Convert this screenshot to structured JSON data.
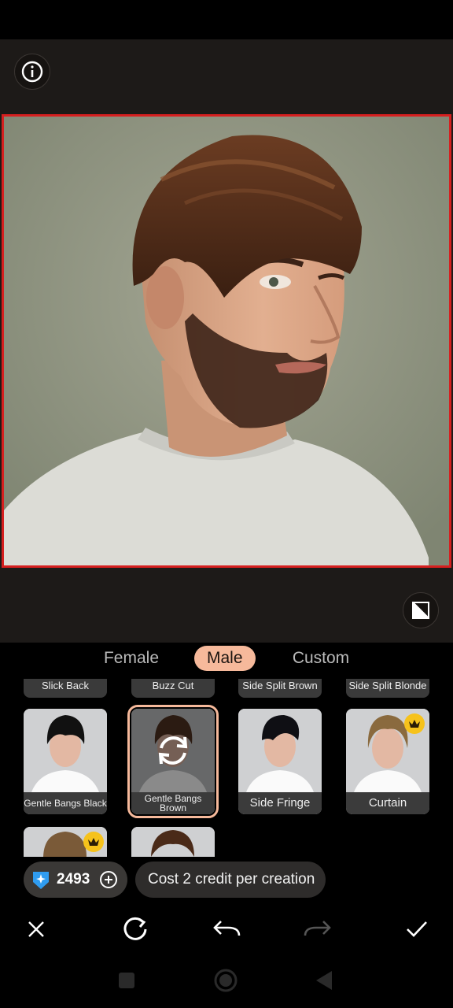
{
  "tabs": [
    {
      "label": "Female",
      "active": false
    },
    {
      "label": "Male",
      "active": true
    },
    {
      "label": "Custom",
      "active": false
    }
  ],
  "styles_row1": [
    "Slick Back",
    "Buzz Cut",
    "Side Split Brown",
    "Side Split Blonde"
  ],
  "styles_row2": [
    {
      "label": "Gentle Bangs Black",
      "premium": false,
      "selected": false
    },
    {
      "label": "Gentle Bangs Brown",
      "premium": false,
      "selected": true
    },
    {
      "label": "Side Fringe",
      "premium": false,
      "selected": false
    },
    {
      "label": "Curtain",
      "premium": true,
      "selected": false
    }
  ],
  "credits": {
    "value": "2493"
  },
  "cost_tip": "Cost 2 credit per creation",
  "icons": {
    "info": "info-icon",
    "compare": "compare-icon",
    "close": "close-icon",
    "regenerate": "refresh-icon",
    "undo": "undo-icon",
    "redo": "redo-icon",
    "confirm": "check-icon",
    "crown": "crown-icon",
    "credit": "credit-gem-icon",
    "add": "plus-circle-icon"
  },
  "colors": {
    "accent": "#f6b99b",
    "crown": "#f6c21b",
    "selection_border": "#d61f1f"
  }
}
